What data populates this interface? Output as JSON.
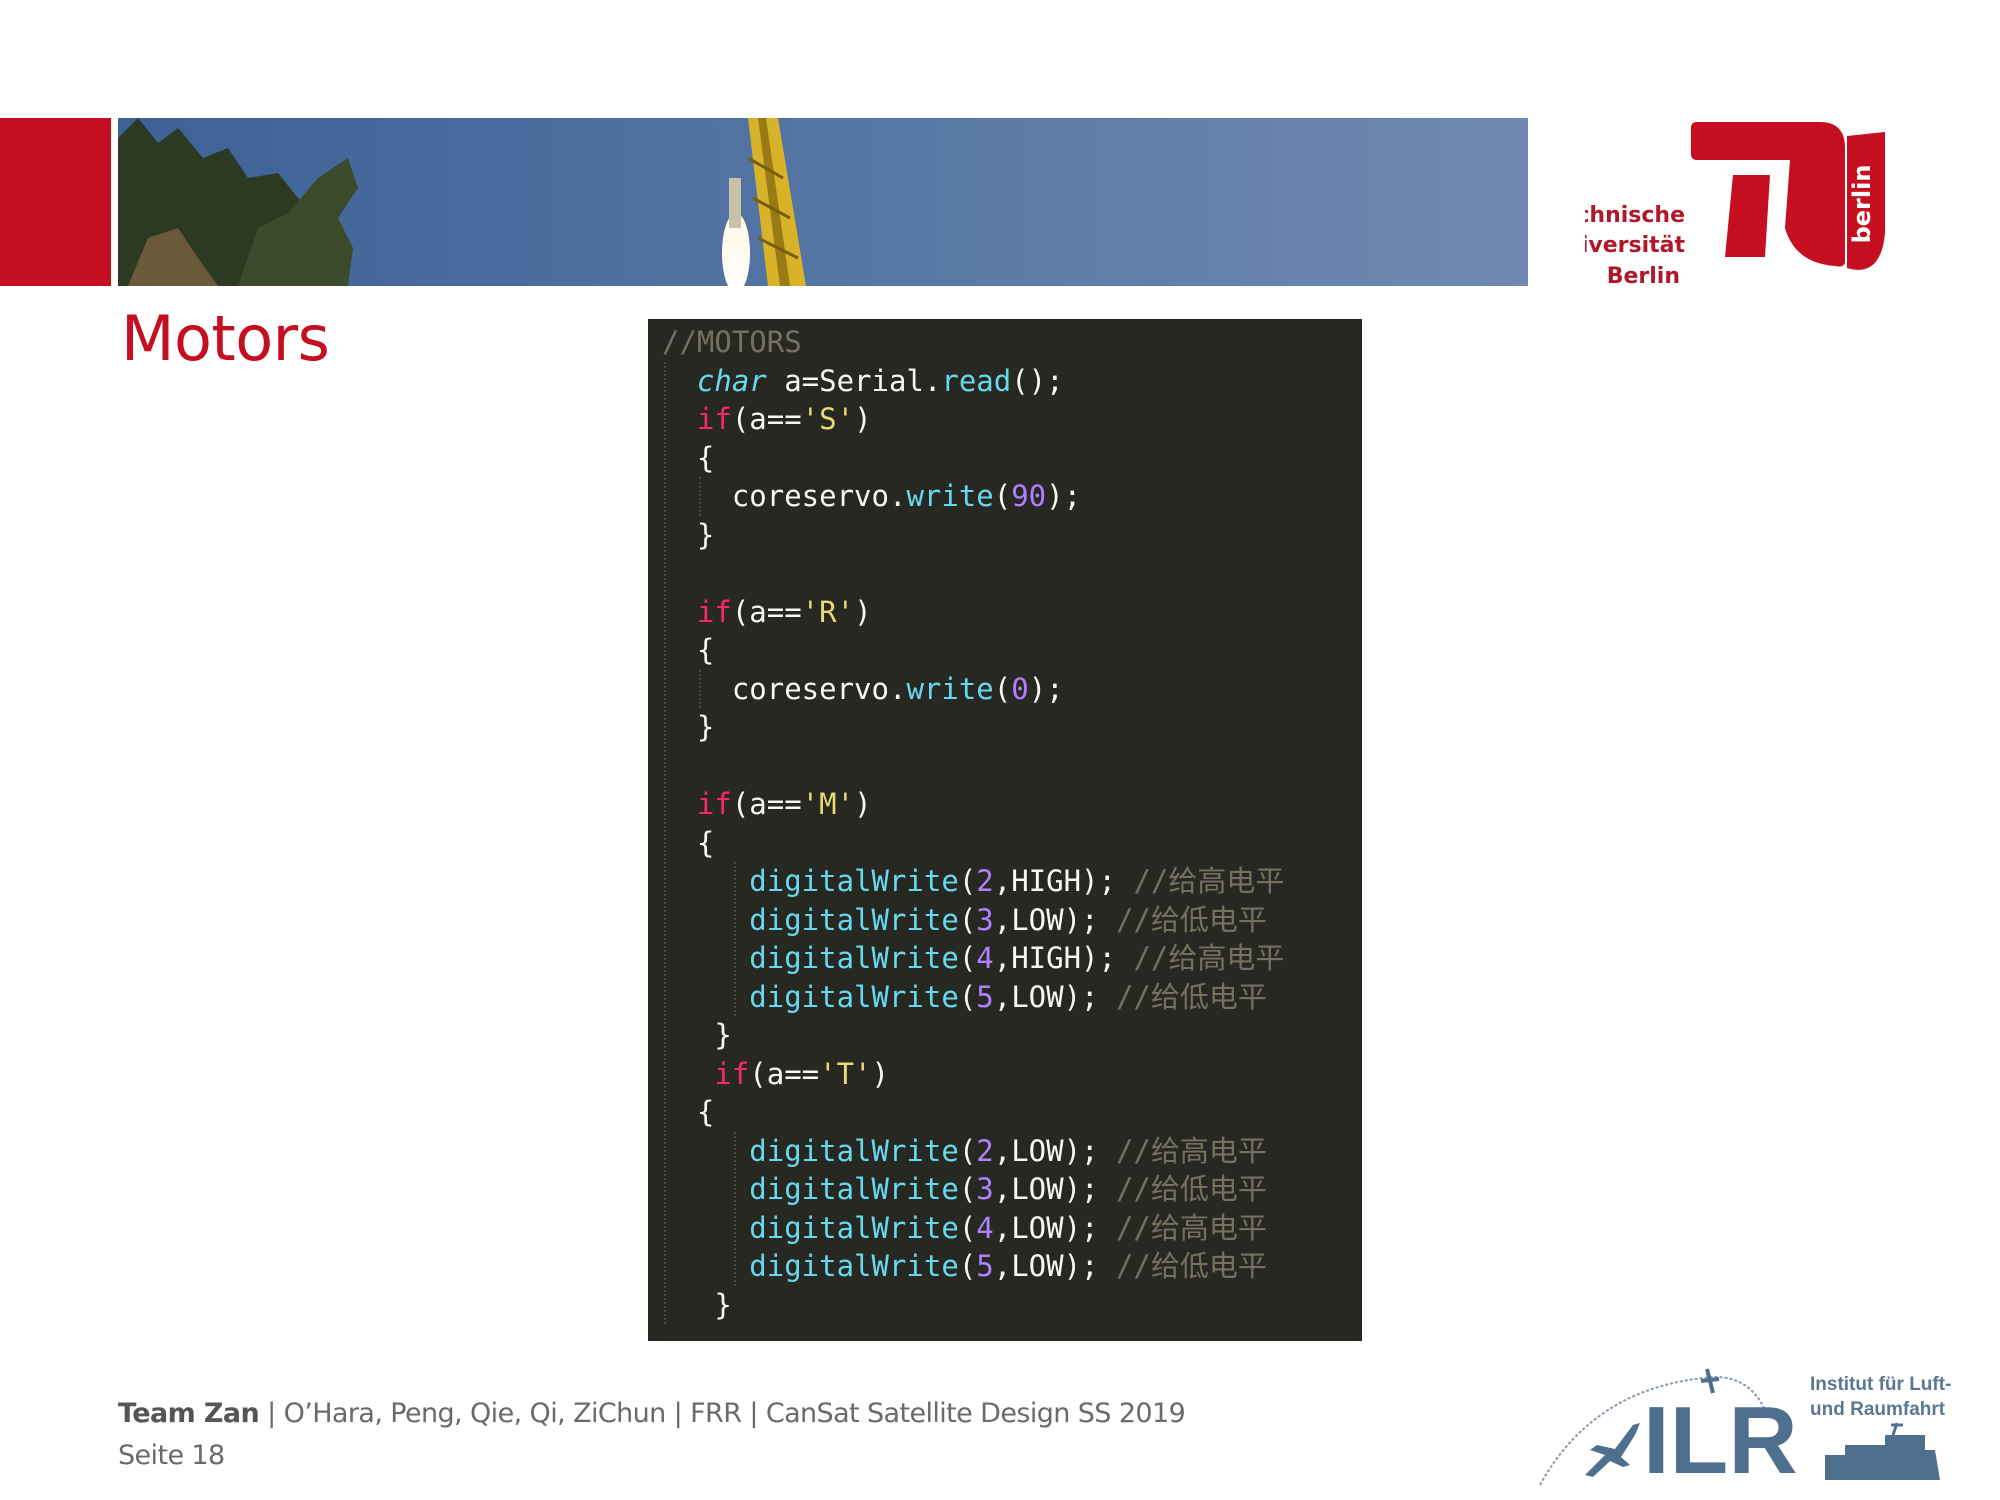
{
  "slide": {
    "title": "Motors",
    "footer": {
      "team": "Team Zan",
      "rest": " | O’Hara, Peng, Qie, Qi, ZiChun | FRR | CanSat Satellite Design SS 2019",
      "page": "Seite 18"
    }
  },
  "logos": {
    "tu": {
      "line1": "Technische",
      "line2": "Universität",
      "line3": "Berlin",
      "vertical": "berlin",
      "color": "#c50e1f"
    },
    "ilr": {
      "letters": "ILR",
      "line1": "Institut für Luft-",
      "line2": "und Raumfahrt",
      "color": "#4f6f8f"
    }
  },
  "colors": {
    "accent": "#c50e1f",
    "code_bg": "#272822"
  },
  "code": {
    "lines": [
      {
        "indent": 0,
        "tokens": [
          [
            "comment",
            "//MOTORS"
          ]
        ]
      },
      {
        "indent": 2,
        "tokens": [
          [
            "type",
            "char"
          ],
          [
            "plain",
            " a=Serial."
          ],
          [
            "fn",
            "read"
          ],
          [
            "plain",
            "();"
          ]
        ]
      },
      {
        "indent": 2,
        "tokens": [
          [
            "kw",
            "if"
          ],
          [
            "plain",
            "(a=="
          ],
          [
            "str",
            "'S'"
          ],
          [
            "plain",
            ")"
          ]
        ]
      },
      {
        "indent": 2,
        "tokens": [
          [
            "plain",
            "{"
          ]
        ]
      },
      {
        "indent": 4,
        "tokens": [
          [
            "plain",
            "coreservo."
          ],
          [
            "fn",
            "write"
          ],
          [
            "plain",
            "("
          ],
          [
            "num",
            "90"
          ],
          [
            "plain",
            ");"
          ]
        ]
      },
      {
        "indent": 2,
        "tokens": [
          [
            "plain",
            "}"
          ]
        ]
      },
      {
        "indent": 0,
        "tokens": []
      },
      {
        "indent": 2,
        "tokens": [
          [
            "kw",
            "if"
          ],
          [
            "plain",
            "(a=="
          ],
          [
            "str",
            "'R'"
          ],
          [
            "plain",
            ")"
          ]
        ]
      },
      {
        "indent": 2,
        "tokens": [
          [
            "plain",
            "{"
          ]
        ]
      },
      {
        "indent": 4,
        "tokens": [
          [
            "plain",
            "coreservo."
          ],
          [
            "fn",
            "write"
          ],
          [
            "plain",
            "("
          ],
          [
            "num",
            "0"
          ],
          [
            "plain",
            ");"
          ]
        ]
      },
      {
        "indent": 2,
        "tokens": [
          [
            "plain",
            "}"
          ]
        ]
      },
      {
        "indent": 0,
        "tokens": []
      },
      {
        "indent": 2,
        "tokens": [
          [
            "kw",
            "if"
          ],
          [
            "plain",
            "(a=="
          ],
          [
            "str",
            "'M'"
          ],
          [
            "plain",
            ")"
          ]
        ]
      },
      {
        "indent": 2,
        "tokens": [
          [
            "plain",
            "{"
          ]
        ]
      },
      {
        "indent": 5,
        "tokens": [
          [
            "fn",
            "digitalWrite"
          ],
          [
            "plain",
            "("
          ],
          [
            "num",
            "2"
          ],
          [
            "plain",
            ",HIGH); "
          ],
          [
            "comment",
            "//给高电平"
          ]
        ]
      },
      {
        "indent": 5,
        "tokens": [
          [
            "fn",
            "digitalWrite"
          ],
          [
            "plain",
            "("
          ],
          [
            "num",
            "3"
          ],
          [
            "plain",
            ",LOW); "
          ],
          [
            "comment",
            "//给低电平"
          ]
        ]
      },
      {
        "indent": 5,
        "tokens": [
          [
            "fn",
            "digitalWrite"
          ],
          [
            "plain",
            "("
          ],
          [
            "num",
            "4"
          ],
          [
            "plain",
            ",HIGH); "
          ],
          [
            "comment",
            "//给高电平"
          ]
        ]
      },
      {
        "indent": 5,
        "tokens": [
          [
            "fn",
            "digitalWrite"
          ],
          [
            "plain",
            "("
          ],
          [
            "num",
            "5"
          ],
          [
            "plain",
            ",LOW); "
          ],
          [
            "comment",
            "//给低电平"
          ]
        ]
      },
      {
        "indent": 3,
        "tokens": [
          [
            "plain",
            "}"
          ]
        ]
      },
      {
        "indent": 3,
        "tokens": [
          [
            "kw",
            "if"
          ],
          [
            "plain",
            "(a=="
          ],
          [
            "str",
            "'T'"
          ],
          [
            "plain",
            ")"
          ]
        ]
      },
      {
        "indent": 2,
        "tokens": [
          [
            "plain",
            "{"
          ]
        ]
      },
      {
        "indent": 5,
        "tokens": [
          [
            "fn",
            "digitalWrite"
          ],
          [
            "plain",
            "("
          ],
          [
            "num",
            "2"
          ],
          [
            "plain",
            ",LOW); "
          ],
          [
            "comment",
            "//给高电平"
          ]
        ]
      },
      {
        "indent": 5,
        "tokens": [
          [
            "fn",
            "digitalWrite"
          ],
          [
            "plain",
            "("
          ],
          [
            "num",
            "3"
          ],
          [
            "plain",
            ",LOW); "
          ],
          [
            "comment",
            "//给低电平"
          ]
        ]
      },
      {
        "indent": 5,
        "tokens": [
          [
            "fn",
            "digitalWrite"
          ],
          [
            "plain",
            "("
          ],
          [
            "num",
            "4"
          ],
          [
            "plain",
            ",LOW); "
          ],
          [
            "comment",
            "//给高电平"
          ]
        ]
      },
      {
        "indent": 5,
        "tokens": [
          [
            "fn",
            "digitalWrite"
          ],
          [
            "plain",
            "("
          ],
          [
            "num",
            "5"
          ],
          [
            "plain",
            ",LOW); "
          ],
          [
            "comment",
            "//给低电平"
          ]
        ]
      },
      {
        "indent": 3,
        "tokens": [
          [
            "plain",
            "}"
          ]
        ]
      }
    ]
  }
}
